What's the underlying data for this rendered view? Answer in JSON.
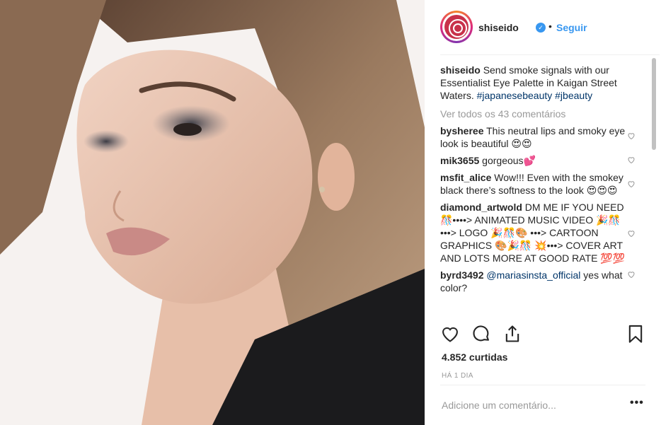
{
  "post": {
    "account": "shiseido",
    "follow_label": "Seguir",
    "separator": "•",
    "caption": {
      "user": "shiseido",
      "text": "Send smoke signals with our Essentialist Eye Palette in Kaigan Street Waters.",
      "hashtags": "#japanesebeauty #jbeauty"
    },
    "view_all": "Ver todos os 43 comentários",
    "comments": [
      {
        "user": "bysheree",
        "text": "This neutral lips and smoky eye look is beautiful 😍😍"
      },
      {
        "user": "mik3655",
        "text": "gorgeous💕"
      },
      {
        "user": "msfit_alice",
        "text": "Wow!!! Even with the smokey black there’s softness to the look 😍😍😍"
      },
      {
        "user": "diamond_artwold",
        "text": "DM ME IF YOU NEED 🎊••••> ANIMATED MUSIC VIDEO 🎉🎊•••> LOGO 🎉🎊🎨 •••> CARTOON GRAPHICS 🎨🎉🎊 💥•••> COVER ART AND LOTS MORE AT GOOD RATE 💯💯"
      },
      {
        "user": "byrd3492",
        "mention": "@mariasinsta_official",
        "text": "yes what color?"
      }
    ],
    "likes": "4.852 curtidas",
    "time": "HÁ 1 DIA",
    "comment_placeholder": "Adicione um comentário...",
    "more_label": "•••"
  },
  "icons": {
    "verified": "verified-badge-icon",
    "like": "heart-icon",
    "comment": "comment-bubble-icon",
    "share": "share-icon",
    "save": "bookmark-icon"
  },
  "colors": {
    "link": "#3897f0",
    "hashtag": "#003569",
    "muted": "#999999",
    "text": "#262626"
  }
}
